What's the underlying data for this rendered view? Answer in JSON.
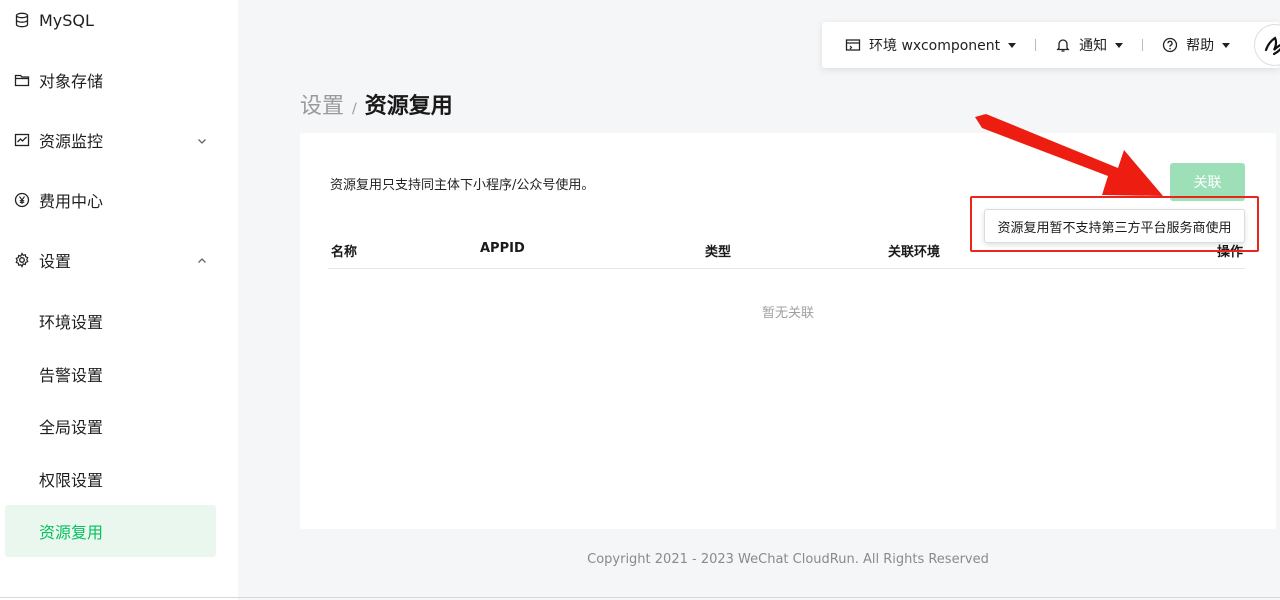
{
  "sidebar": {
    "items": [
      {
        "label": "MySQL",
        "icon": "database-icon"
      },
      {
        "label": "对象存储",
        "icon": "folder-icon"
      },
      {
        "label": "资源监控",
        "icon": "chart-icon"
      },
      {
        "label": "费用中心",
        "icon": "yen-icon"
      },
      {
        "label": "设置",
        "icon": "gear-icon"
      }
    ],
    "sub_items": [
      {
        "label": "环境设置"
      },
      {
        "label": "告警设置"
      },
      {
        "label": "全局设置"
      },
      {
        "label": "权限设置"
      },
      {
        "label": "资源复用",
        "active": true
      }
    ]
  },
  "topbar": {
    "env_label": "环境 wxcomponent",
    "notify_label": "通知",
    "help_label": "帮助"
  },
  "breadcrumb": {
    "parent": "设置",
    "separator": "/",
    "current": "资源复用"
  },
  "card": {
    "description": "资源复用只支持同主体下小程序/公众号使用。",
    "link_button": "关联",
    "table": {
      "headers": [
        "名称",
        "APPID",
        "类型",
        "关联环境",
        "操作"
      ],
      "empty_text": "暂无关联"
    }
  },
  "tooltip": {
    "text": "资源复用暂不支持第三方平台服务商使用"
  },
  "footer": {
    "copyright": "Copyright 2021 - 2023 WeChat CloudRun. All Rights Reserved"
  },
  "colors": {
    "accent": "#07c160",
    "button_disabled": "#9de0b8",
    "annotation_red": "#e8261e",
    "active_bg": "#eaf7ee"
  }
}
